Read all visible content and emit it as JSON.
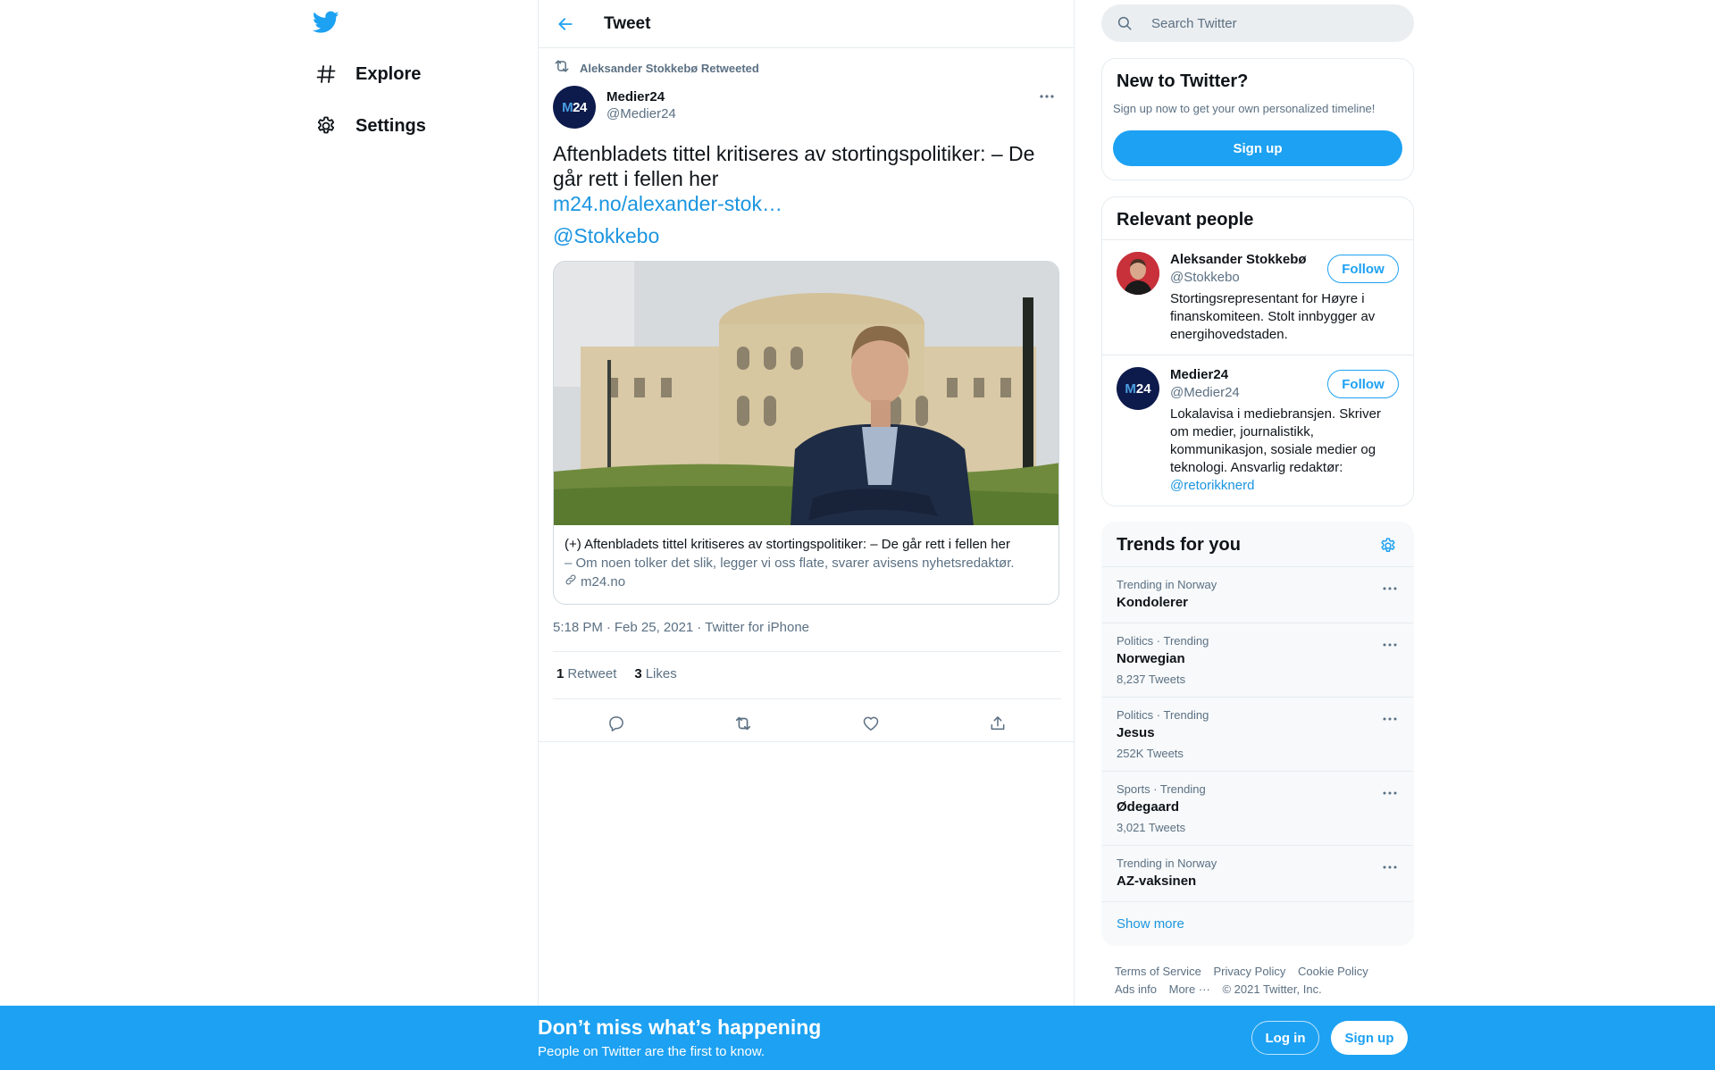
{
  "nav": {
    "logo_icon": "twitter-bird-icon",
    "items": [
      {
        "label": "Explore",
        "icon": "hashtag-icon"
      },
      {
        "label": "Settings",
        "icon": "gear-icon"
      }
    ]
  },
  "header": {
    "title": "Tweet",
    "back_icon": "arrow-left-icon"
  },
  "tweet": {
    "retweet_context": "Aleksander Stokkebø Retweeted",
    "author_name": "Medier24",
    "author_handle": "@Medier24",
    "avatar_text_m": "M",
    "avatar_text_24": "24",
    "text": "Aftenbladets tittel kritiseres av stortingspolitiker: – De går rett i fellen her",
    "link": "m24.no/alexander-stok…",
    "mention": "@Stokkebo",
    "card": {
      "title": "(+) Aftenbladets tittel kritiseres av stortingspolitiker: – De går rett i fellen her",
      "description": "– Om noen tolker det slik, legger vi oss flate, svarer avisens nyhetsredaktør.",
      "domain": "m24.no"
    },
    "time": "5:18 PM",
    "date": "Feb 25, 2021",
    "source": "Twitter for iPhone",
    "sep": "·",
    "retweets_count": "1",
    "retweets_label": "Retweet",
    "likes_count": "3",
    "likes_label": "Likes"
  },
  "search": {
    "placeholder": "Search Twitter"
  },
  "new_to_twitter": {
    "title": "New to Twitter?",
    "subtitle": "Sign up now to get your own personalized timeline!",
    "button": "Sign up"
  },
  "relevant_people": {
    "title": "Relevant people",
    "people": [
      {
        "name": "Aleksander Stokkebø",
        "handle": "@Stokkebo",
        "bio": "Stortingsrepresentant for Høyre i finanskomiteen. Stolt innbygger av energihovedstaden.",
        "bio_link": "",
        "follow": "Follow"
      },
      {
        "name": "Medier24",
        "handle": "@Medier24",
        "bio": "Lokalavisa i mediebransjen. Skriver om medier, journalistikk, kommunikasjon, sosiale medier og teknologi. Ansvarlig redaktør:",
        "bio_link": "@retorikknerd",
        "follow": "Follow"
      }
    ]
  },
  "trends": {
    "title": "Trends for you",
    "items": [
      {
        "context": "Trending in Norway",
        "name": "Kondolerer",
        "count": ""
      },
      {
        "context": "Politics · Trending",
        "name": "Norwegian",
        "count": "8,237 Tweets"
      },
      {
        "context": "Politics · Trending",
        "name": "Jesus",
        "count": "252K Tweets"
      },
      {
        "context": "Sports · Trending",
        "name": "Ødegaard",
        "count": "3,021 Tweets"
      },
      {
        "context": "Trending in Norway",
        "name": "AZ-vaksinen",
        "count": ""
      }
    ],
    "show_more": "Show more"
  },
  "footer": {
    "terms": "Terms of Service",
    "privacy": "Privacy Policy",
    "cookie": "Cookie Policy",
    "ads": "Ads info",
    "more": "More ···",
    "copyright": "© 2021 Twitter, Inc."
  },
  "bottom_bar": {
    "title": "Don’t miss what’s happening",
    "subtitle": "People on Twitter are the first to know.",
    "login": "Log in",
    "signup": "Sign up"
  },
  "colors": {
    "accent": "#1da1f2",
    "link": "#1b95e0",
    "secondary_text": "#5b7083"
  }
}
